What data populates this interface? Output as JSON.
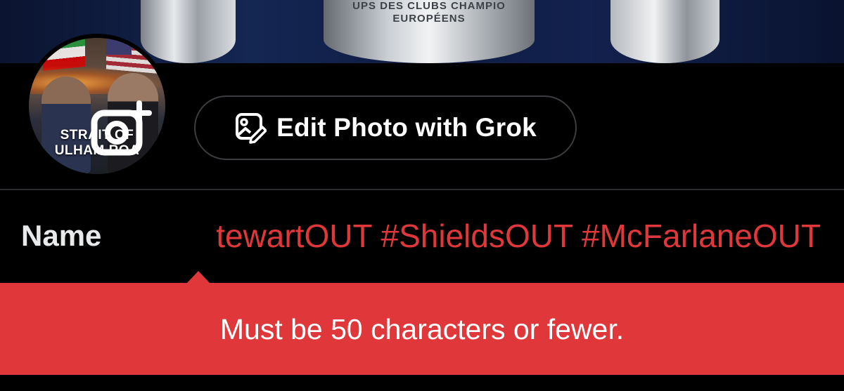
{
  "banner": {
    "trophy_engraving": "UPS DES CLUBS CHAMPIO\nEUROPÉENS"
  },
  "avatar": {
    "caption_line1": "STRAIT OF",
    "caption_line2": "ULHAM ROA",
    "overlay_icon": "camera-plus-icon"
  },
  "grok_button": {
    "icon": "image-edit-icon",
    "label": "Edit Photo with Grok"
  },
  "name_field": {
    "label": "Name",
    "value": "#StewartOUT #ShieldsOUT #McFarlaneOUT",
    "visible_value": "tewartOUT #ShieldsOUT #McFarlaneOUT"
  },
  "error": {
    "message": "Must be 50 characters or fewer."
  },
  "colors": {
    "background": "#000000",
    "error": "#E0383A",
    "text": "#FFFFFF",
    "button_border": "#3B3D40"
  }
}
